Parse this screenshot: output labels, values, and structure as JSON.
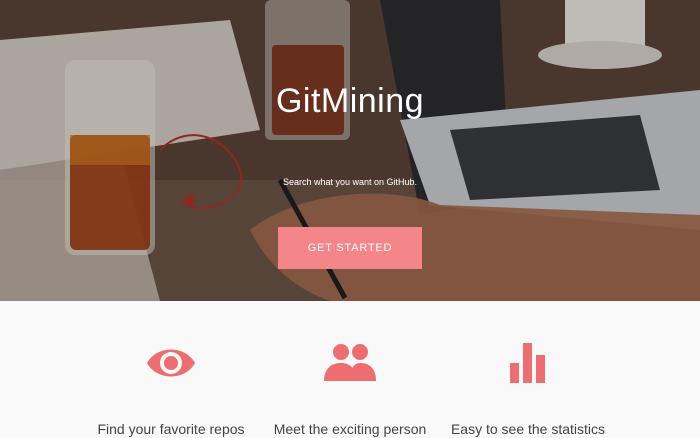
{
  "hero": {
    "title": "GitMining",
    "tagline": "Search what you want on GitHub.",
    "cta_label": "GET STARTED"
  },
  "features": [
    {
      "icon": "eye-icon",
      "label": "Find your favorite repos"
    },
    {
      "icon": "people-icon",
      "label": "Meet the exciting person"
    },
    {
      "icon": "bar-chart-icon",
      "label": "Easy to see the statistics"
    }
  ],
  "colors": {
    "accent": "#f4868a",
    "icon": "#ee6d70",
    "text": "#444444",
    "background": "#f9f9f9"
  }
}
